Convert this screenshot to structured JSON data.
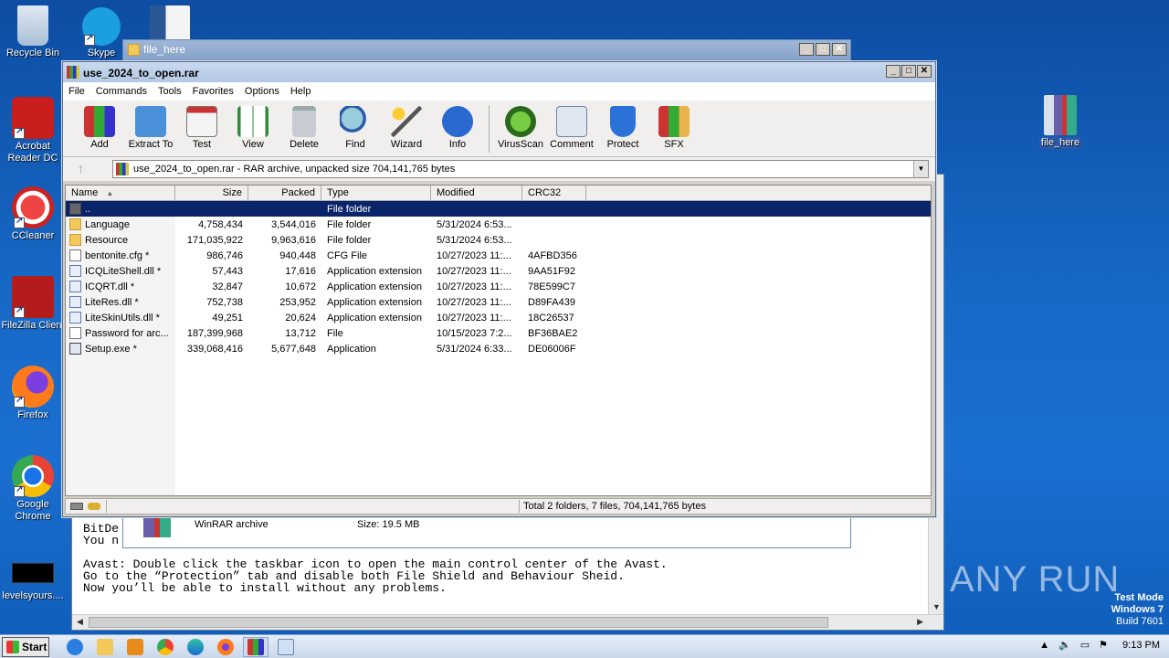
{
  "desktop": {
    "icons": [
      {
        "label": "Recycle Bin"
      },
      {
        "label": "Skype"
      },
      {
        "label": "Acrobat Reader DC"
      },
      {
        "label": "CCleaner"
      },
      {
        "label": "FileZilla Client"
      },
      {
        "label": "Firefox"
      },
      {
        "label": "Google Chrome"
      },
      {
        "label": "levelsyours...."
      },
      {
        "label": "file_here"
      }
    ]
  },
  "editor": {
    "lines": [
      "BitDe",
      "You n",
      "Avast: Double click the taskbar icon to open the main control center of the Avast.",
      "Go to the “Protection” tab and disable both File Shield and Behaviour Sheid.",
      "Now you’ll be able to install without any problems."
    ]
  },
  "folder_window": {
    "title": "file_here",
    "item_type": "WinRAR archive",
    "item_size": "Size: 19.5 MB"
  },
  "winrar": {
    "title": "use_2024_to_open.rar",
    "menu": [
      "File",
      "Commands",
      "Tools",
      "Favorites",
      "Options",
      "Help"
    ],
    "toolbar": [
      "Add",
      "Extract To",
      "Test",
      "View",
      "Delete",
      "Find",
      "Wizard",
      "Info",
      "VirusScan",
      "Comment",
      "Protect",
      "SFX"
    ],
    "address": "use_2024_to_open.rar - RAR archive, unpacked size 704,141,765 bytes",
    "columns": [
      "Name",
      "Size",
      "Packed",
      "Type",
      "Modified",
      "CRC32"
    ],
    "rows": [
      {
        "name": "..",
        "size": "",
        "packed": "",
        "type": "File folder",
        "modified": "",
        "crc": "",
        "kind": "up"
      },
      {
        "name": "Language",
        "size": "4,758,434",
        "packed": "3,544,016",
        "type": "File folder",
        "modified": "5/31/2024 6:53...",
        "crc": "",
        "kind": "folder"
      },
      {
        "name": "Resource",
        "size": "171,035,922",
        "packed": "9,963,616",
        "type": "File folder",
        "modified": "5/31/2024 6:53...",
        "crc": "",
        "kind": "folder"
      },
      {
        "name": "bentonite.cfg *",
        "size": "986,746",
        "packed": "940,448",
        "type": "CFG File",
        "modified": "10/27/2023 11:...",
        "crc": "4AFBD356",
        "kind": "file"
      },
      {
        "name": "ICQLiteShell.dll *",
        "size": "57,443",
        "packed": "17,616",
        "type": "Application extension",
        "modified": "10/27/2023 11:...",
        "crc": "9AA51F92",
        "kind": "dll"
      },
      {
        "name": "ICQRT.dll *",
        "size": "32,847",
        "packed": "10,672",
        "type": "Application extension",
        "modified": "10/27/2023 11:...",
        "crc": "78E599C7",
        "kind": "dll"
      },
      {
        "name": "LiteRes.dll *",
        "size": "752,738",
        "packed": "253,952",
        "type": "Application extension",
        "modified": "10/27/2023 11:...",
        "crc": "D89FA439",
        "kind": "dll"
      },
      {
        "name": "LiteSkinUtils.dll *",
        "size": "49,251",
        "packed": "20,624",
        "type": "Application extension",
        "modified": "10/27/2023 11:...",
        "crc": "18C26537",
        "kind": "dll"
      },
      {
        "name": "Password for arc...",
        "size": "187,399,968",
        "packed": "13,712",
        "type": "File",
        "modified": "10/15/2023 7:2...",
        "crc": "BF36BAE2",
        "kind": "file"
      },
      {
        "name": "Setup.exe *",
        "size": "339,068,416",
        "packed": "5,677,648",
        "type": "Application",
        "modified": "5/31/2024 6:33...",
        "crc": "DE06006F",
        "kind": "exe"
      }
    ],
    "status": "Total 2 folders, 7 files, 704,141,765 bytes"
  },
  "watermark": "ANY RUN",
  "testmode": {
    "line1": "Test Mode",
    "line2": "Windows 7",
    "line3": "Build 7601"
  },
  "taskbar": {
    "start": "Start",
    "time": "9:13 PM"
  }
}
